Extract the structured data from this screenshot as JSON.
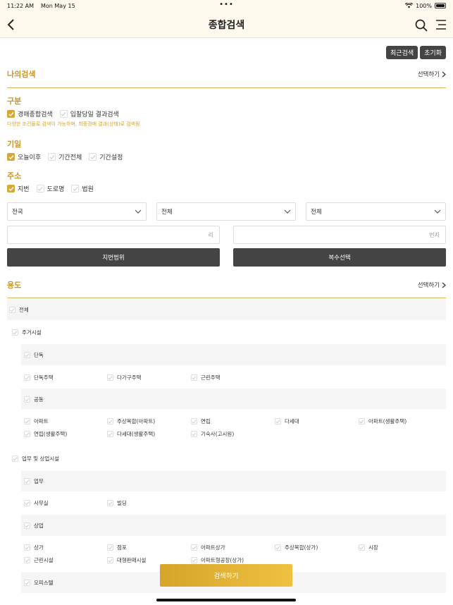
{
  "status": {
    "time": "11:22 AM",
    "date": "Mon May 15",
    "battery": "100%"
  },
  "header": {
    "title": "종합검색"
  },
  "top_buttons": {
    "recent": "최근검색",
    "reset": "초기화"
  },
  "my_search": {
    "title": "나의검색",
    "link": "선택하기"
  },
  "category": {
    "label": "구분",
    "options": [
      {
        "label": "경매종합검색",
        "checked": true
      },
      {
        "label": "입찰당일 결과검색",
        "checked": false
      }
    ],
    "note": "다양한 조건들로 검색이 가능하며, 최종경매 결과(상태)로 검색됨"
  },
  "period": {
    "label": "기일",
    "options": [
      {
        "label": "오늘이후",
        "checked": true
      },
      {
        "label": "기간전체",
        "checked": false
      },
      {
        "label": "기간설정",
        "checked": false
      }
    ]
  },
  "address": {
    "label": "주소",
    "options": [
      {
        "label": "지번",
        "checked": true
      },
      {
        "label": "도로명",
        "checked": false
      },
      {
        "label": "법원",
        "checked": false
      }
    ],
    "select1": "전국",
    "select2": "전체",
    "select3": "전체",
    "input1_hint": "리",
    "input2_hint": "번지",
    "btn_range": "지번범위",
    "btn_multi": "복수선택"
  },
  "usage": {
    "title": "용도",
    "link": "선택하기"
  },
  "tree": {
    "all": "전체",
    "residential": "주거시설",
    "single": "단독",
    "single_items": [
      "단독주택",
      "다가구주택",
      "근린주택"
    ],
    "shared": "공동",
    "shared_items_row1": [
      "아파트",
      "주상복합(아파트)",
      "연립",
      "다세대",
      "아파트(생활주택)"
    ],
    "shared_items_row2": [
      "연립(생활주택)",
      "다세대(생활주택)",
      "기숙사(고시원)"
    ],
    "commercial": "업무 및 상업시설",
    "business": "업무",
    "business_items": [
      "사무실",
      "빌딩"
    ],
    "shop": "상업",
    "shop_items_row1": [
      "상가",
      "점포",
      "아파트상가",
      "주상복합(상가)",
      "시장"
    ],
    "shop_items_row2": [
      "근린시설",
      "대형판매시설",
      "아파트형공장(상가)"
    ],
    "office": "오피스텔"
  },
  "cta": "검색하기"
}
